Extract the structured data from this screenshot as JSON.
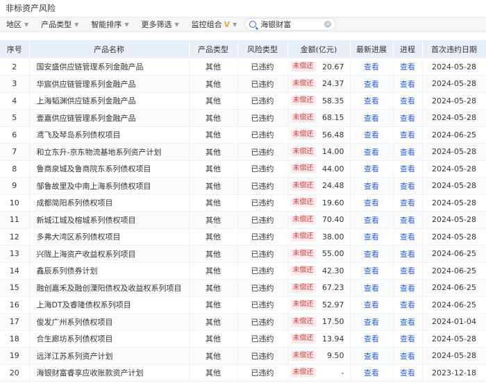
{
  "page": {
    "title": "非标资产风险"
  },
  "filters": [
    {
      "label": "地区",
      "name": "filter-region"
    },
    {
      "label": "产品类型",
      "name": "filter-product-type"
    },
    {
      "label": "智能排序",
      "name": "filter-smart-sort"
    },
    {
      "label": "更多筛选",
      "name": "filter-more"
    },
    {
      "label": "监控组合",
      "name": "filter-monitor-group"
    }
  ],
  "search": {
    "value": "海银财富"
  },
  "table": {
    "headers": [
      "序号",
      "产品名称",
      "产品类型",
      "风险类型",
      "金额(亿元)",
      "最新进展",
      "进程",
      "首次违约日期"
    ],
    "rows": [
      {
        "idx": "2",
        "name": "国安盛供应链管理系列金融产品",
        "type": "其他",
        "risk": "已违约",
        "status": "未偿还",
        "amount": "20.67",
        "view": "查看",
        "progress": "查看",
        "date": "2024-05-28"
      },
      {
        "idx": "3",
        "name": "华宸供应链管理系列金融产品",
        "type": "其他",
        "risk": "已违约",
        "status": "未偿还",
        "amount": "24.37",
        "view": "查看",
        "progress": "查看",
        "date": "2024-05-28"
      },
      {
        "idx": "4",
        "name": "上海韬渊供应链系列金融产品",
        "type": "其他",
        "risk": "已违约",
        "status": "未偿还",
        "amount": "58.35",
        "view": "查看",
        "progress": "查看",
        "date": "2024-05-28"
      },
      {
        "idx": "5",
        "name": "壹嘉供应链管理系列金融产品",
        "type": "其他",
        "risk": "已违约",
        "status": "未偿还",
        "amount": "68.15",
        "view": "查看",
        "progress": "查看",
        "date": "2024-05-28"
      },
      {
        "idx": "6",
        "name": "鸢飞及琴岛系列债权项目",
        "type": "其他",
        "risk": "已违约",
        "status": "未偿还",
        "amount": "56.48",
        "view": "查看",
        "progress": "查看",
        "date": "2024-06-25"
      },
      {
        "idx": "7",
        "name": "和立东升-京东物流基地系列资产计划",
        "type": "其他",
        "risk": "已违约",
        "status": "未偿还",
        "amount": "14.00",
        "view": "查看",
        "progress": "查看",
        "date": "2024-05-28"
      },
      {
        "idx": "8",
        "name": "鲁商泉城及鲁商院东系列债权项目",
        "type": "其他",
        "risk": "已违约",
        "status": "未偿还",
        "amount": "44.00",
        "view": "查看",
        "progress": "查看",
        "date": "2024-05-28"
      },
      {
        "idx": "9",
        "name": "邹鲁故里及中南上海系列债权项目",
        "type": "其他",
        "risk": "已违约",
        "status": "未偿还",
        "amount": "24.48",
        "view": "查看",
        "progress": "查看",
        "date": "2024-05-28"
      },
      {
        "idx": "10",
        "name": "成都简阳系列债权项目",
        "type": "其他",
        "risk": "已违约",
        "status": "未偿还",
        "amount": "19.60",
        "view": "查看",
        "progress": "查看",
        "date": "2024-05-28"
      },
      {
        "idx": "11",
        "name": "新城江城及榕城系列债权项目",
        "type": "其他",
        "risk": "已违约",
        "status": "未偿还",
        "amount": "70.40",
        "view": "查看",
        "progress": "查看",
        "date": "2024-05-28"
      },
      {
        "idx": "12",
        "name": "多弗大湾区系列债权项目",
        "type": "其他",
        "risk": "已违约",
        "status": "未偿还",
        "amount": "38.00",
        "view": "查看",
        "progress": "查看",
        "date": "2024-05-28"
      },
      {
        "idx": "13",
        "name": "兴陇上海资产收益权系列项目",
        "type": "其他",
        "risk": "已违约",
        "status": "未偿还",
        "amount": "55.00",
        "view": "查看",
        "progress": "查看",
        "date": "2024-06-25"
      },
      {
        "idx": "14",
        "name": "鑫辰系列债券计划",
        "type": "其他",
        "risk": "已违约",
        "status": "未偿还",
        "amount": "42.30",
        "view": "查看",
        "progress": "查看",
        "date": "2024-06-25"
      },
      {
        "idx": "15",
        "name": "融创嘉禾及融创溧阳债权及收益权系列项目",
        "type": "其他",
        "risk": "已违约",
        "status": "未偿还",
        "amount": "67.23",
        "view": "查看",
        "progress": "查看",
        "date": "2024-06-25"
      },
      {
        "idx": "16",
        "name": "上海DT及睿隆债权系列项目",
        "type": "其他",
        "risk": "已违约",
        "status": "未偿还",
        "amount": "52.97",
        "view": "查看",
        "progress": "查看",
        "date": "2024-06-25"
      },
      {
        "idx": "17",
        "name": "俊发广州系列债权项目",
        "type": "其他",
        "risk": "已违约",
        "status": "未偿还",
        "amount": "17.50",
        "view": "查看",
        "progress": "查看",
        "date": "2024-01-04"
      },
      {
        "idx": "18",
        "name": "合生廊坊系列债权项目",
        "type": "其他",
        "risk": "已违约",
        "status": "未偿还",
        "amount": "13.94",
        "view": "查看",
        "progress": "查看",
        "date": "2024-05-28"
      },
      {
        "idx": "19",
        "name": "远洋江苏系列资产计划",
        "type": "其他",
        "risk": "已违约",
        "status": "未偿还",
        "amount": "9.50",
        "view": "查看",
        "progress": "查看",
        "date": "2024-05-28"
      },
      {
        "idx": "20",
        "name": "海银财富睿享应收账款资产计划",
        "type": "其他",
        "risk": "已违约",
        "status": "未偿还",
        "amount": "-",
        "view": "查看",
        "progress": "查看",
        "date": "2023-12-18"
      }
    ]
  }
}
